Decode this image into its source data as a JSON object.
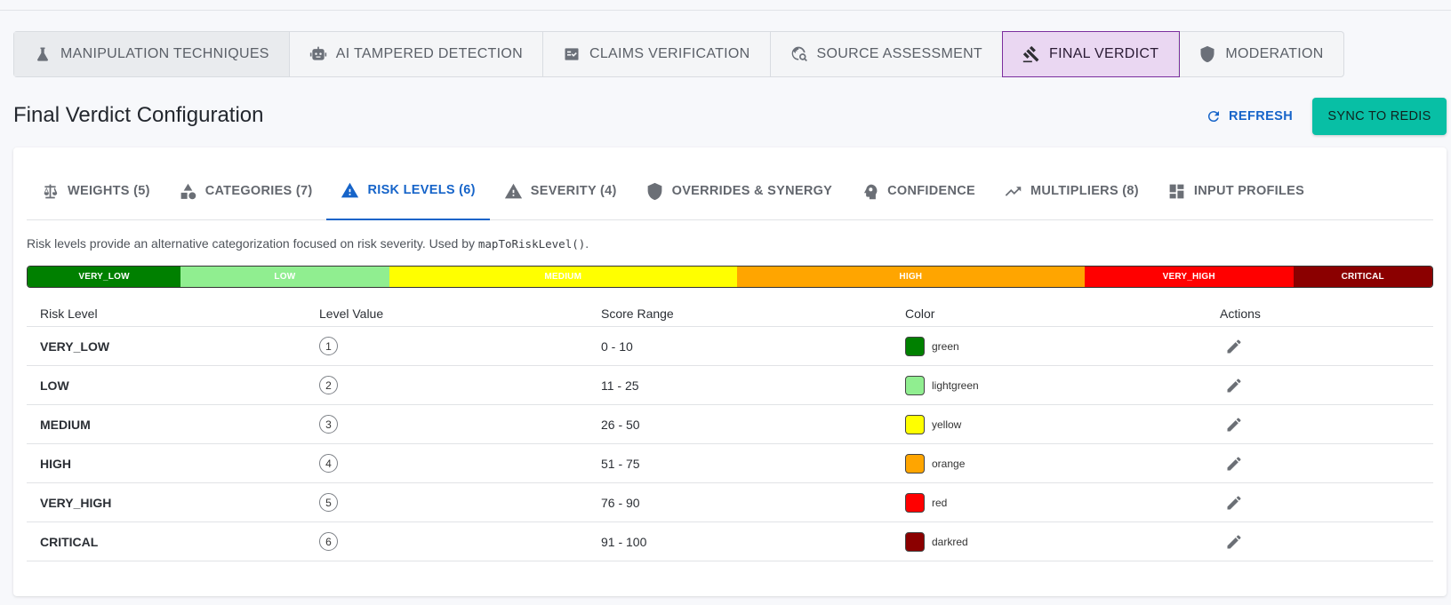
{
  "main_tabs": [
    {
      "label": "MANIPULATION TECHNIQUES"
    },
    {
      "label": "AI TAMPERED DETECTION"
    },
    {
      "label": "CLAIMS VERIFICATION"
    },
    {
      "label": "SOURCE ASSESSMENT"
    },
    {
      "label": "FINAL VERDICT"
    },
    {
      "label": "MODERATION"
    }
  ],
  "header": {
    "title": "Final Verdict Configuration",
    "refresh_label": "REFRESH",
    "sync_label": "SYNC TO REDIS"
  },
  "sub_tabs": [
    {
      "label": "WEIGHTS (5)"
    },
    {
      "label": "CATEGORIES (7)"
    },
    {
      "label": "RISK LEVELS (6)"
    },
    {
      "label": "SEVERITY (4)"
    },
    {
      "label": "OVERRIDES & SYNERGY"
    },
    {
      "label": "CONFIDENCE"
    },
    {
      "label": "MULTIPLIERS (8)"
    },
    {
      "label": "INPUT PROFILES"
    }
  ],
  "description": {
    "text": "Risk levels provide an alternative categorization focused on risk severity. Used by ",
    "code": "mapToRiskLevel()",
    "suffix": "."
  },
  "risk_bar": [
    {
      "label": "VERY_LOW",
      "range": [
        0,
        10
      ],
      "color": "#008000"
    },
    {
      "label": "LOW",
      "range": [
        11,
        25
      ],
      "color": "#90ee90"
    },
    {
      "label": "MEDIUM",
      "range": [
        26,
        50
      ],
      "color": "#ffff00"
    },
    {
      "label": "HIGH",
      "range": [
        51,
        75
      ],
      "color": "#ffa500"
    },
    {
      "label": "VERY_HIGH",
      "range": [
        76,
        90
      ],
      "color": "#ff0000"
    },
    {
      "label": "CRITICAL",
      "range": [
        91,
        100
      ],
      "color": "#8b0000"
    }
  ],
  "table": {
    "headers": [
      "Risk Level",
      "Level Value",
      "Score Range",
      "Color",
      "Actions"
    ],
    "rows": [
      {
        "level": "VERY_LOW",
        "value": "1",
        "range": "0 - 10",
        "color_name": "green",
        "color": "#008000"
      },
      {
        "level": "LOW",
        "value": "2",
        "range": "11 - 25",
        "color_name": "lightgreen",
        "color": "#90ee90"
      },
      {
        "level": "MEDIUM",
        "value": "3",
        "range": "26 - 50",
        "color_name": "yellow",
        "color": "#ffff00"
      },
      {
        "level": "HIGH",
        "value": "4",
        "range": "51 - 75",
        "color_name": "orange",
        "color": "#ffa500"
      },
      {
        "level": "VERY_HIGH",
        "value": "5",
        "range": "76 - 90",
        "color_name": "red",
        "color": "#ff0000"
      },
      {
        "level": "CRITICAL",
        "value": "6",
        "range": "91 - 100",
        "color_name": "darkred",
        "color": "#8b0000"
      }
    ]
  },
  "accent_colors": {
    "primary": "#1664c9",
    "sync_button": "#08bfa5",
    "active_main_tab": "#ead7f2"
  }
}
